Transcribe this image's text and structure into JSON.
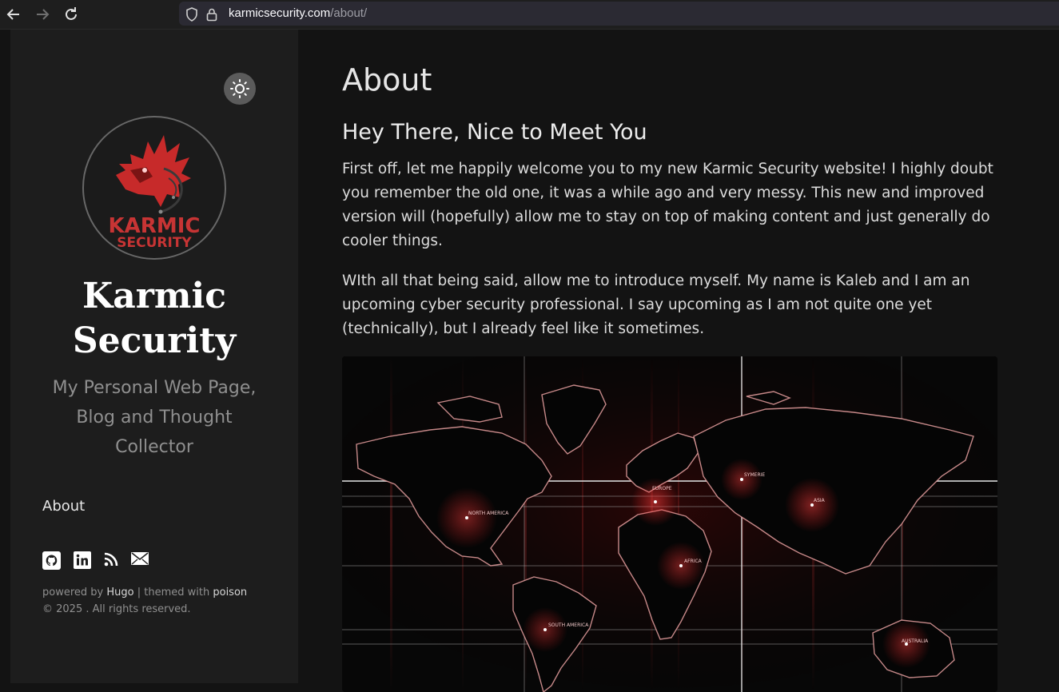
{
  "browser": {
    "url_domain": "karmicsecurity.com",
    "url_path": "/about/",
    "icons": [
      "back-arrow-icon",
      "forward-arrow-icon",
      "reload-icon",
      "shield-icon",
      "lock-icon"
    ]
  },
  "sidebar": {
    "logo_text_line1": "KARMIC",
    "logo_text_line2": "SECURITY",
    "brand_line1": "Karmic",
    "brand_line2": "Security",
    "tagline": "My Personal Web Page, Blog and Thought Collector",
    "menu": [
      {
        "label": "About"
      }
    ],
    "social_icons": [
      "github-icon",
      "linkedin-icon",
      "rss-icon",
      "email-icon"
    ],
    "footer": {
      "powered_by": "powered by",
      "hugo": "Hugo",
      "separator": " | themed with ",
      "poison": "poison",
      "copyright": "© 2025 . All rights reserved."
    }
  },
  "main": {
    "title": "About",
    "subtitle": "Hey There, Nice to Meet You",
    "paragraphs": [
      "First off, let me happily welcome you to my new Karmic Security website! I highly doubt you remember the old one, it was a while ago and very messy. This new and improved version will (hopefully) allow me to stay on top of making content and just generally do cooler things.",
      "WIth all that being said, allow me to introduce myself. My name is Kaleb and I am an upcoming cyber security professional. I say upcoming as I am not quite one yet (technically), but I already feel like it sometimes."
    ],
    "map_labels": {
      "north_america": "NORTH AMERICA",
      "europe": "EUROPE",
      "asia": "ASIA",
      "africa": "AFRICA",
      "south_america": "SOUTH AMERICA",
      "australia": "AUSTRALIA",
      "siberia": "SYMERIE"
    }
  },
  "colors": {
    "sidebar_bg": "#1d1d1d",
    "main_bg": "#131313",
    "accent_red": "#e03a3a",
    "text": "#dcdcdc"
  }
}
